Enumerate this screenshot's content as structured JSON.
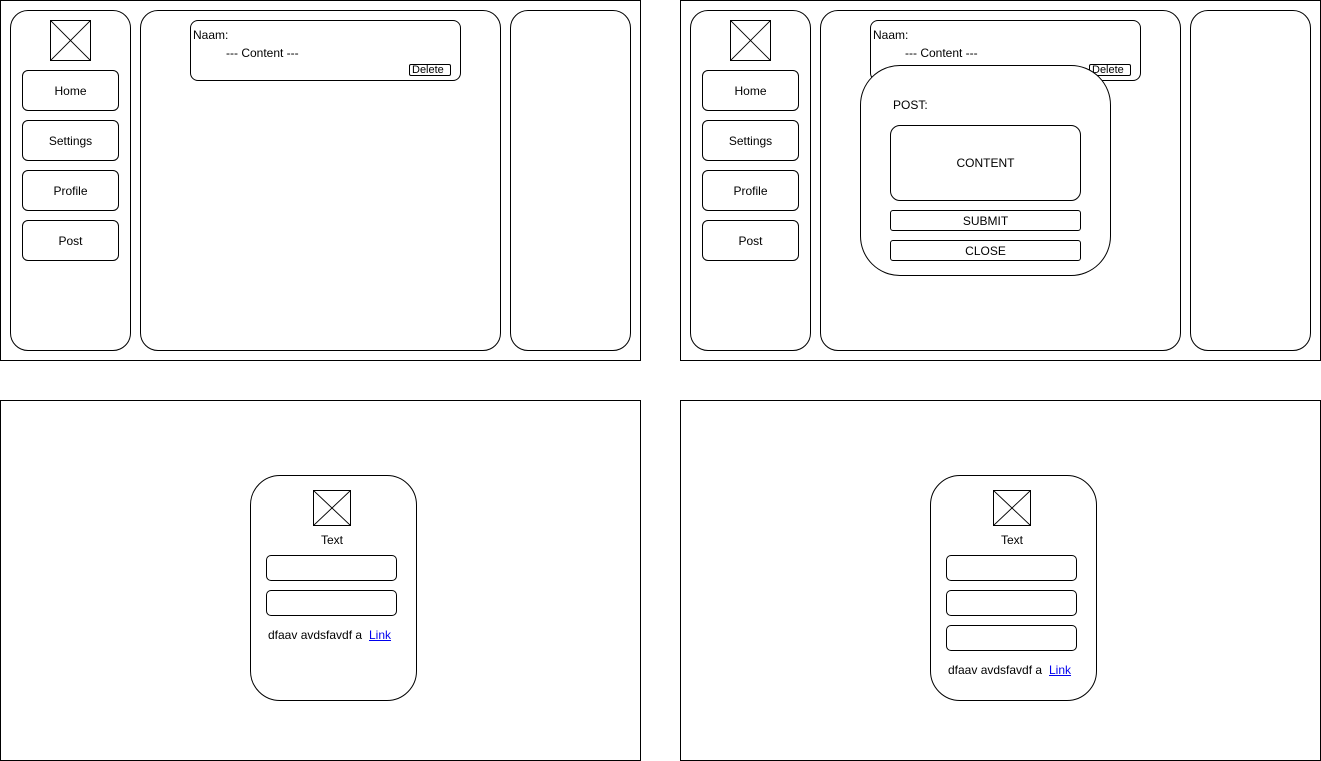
{
  "nav": {
    "home": "Home",
    "settings": "Settings",
    "profile": "Profile",
    "post": "Post"
  },
  "post_card": {
    "name_label": "Naam:",
    "content": "--- Content ---",
    "delete_label": "Delete"
  },
  "popup": {
    "title": "POST:",
    "content_placeholder": "CONTENT",
    "submit_label": "SUBMIT",
    "close_label": "CLOSE"
  },
  "login": {
    "text": "Text",
    "footer_text": "dfaav avdsfavdf a",
    "link_text": "Link"
  },
  "register": {
    "text": "Text",
    "footer_text": "dfaav avdsfavdf a",
    "link_text": "Link"
  }
}
